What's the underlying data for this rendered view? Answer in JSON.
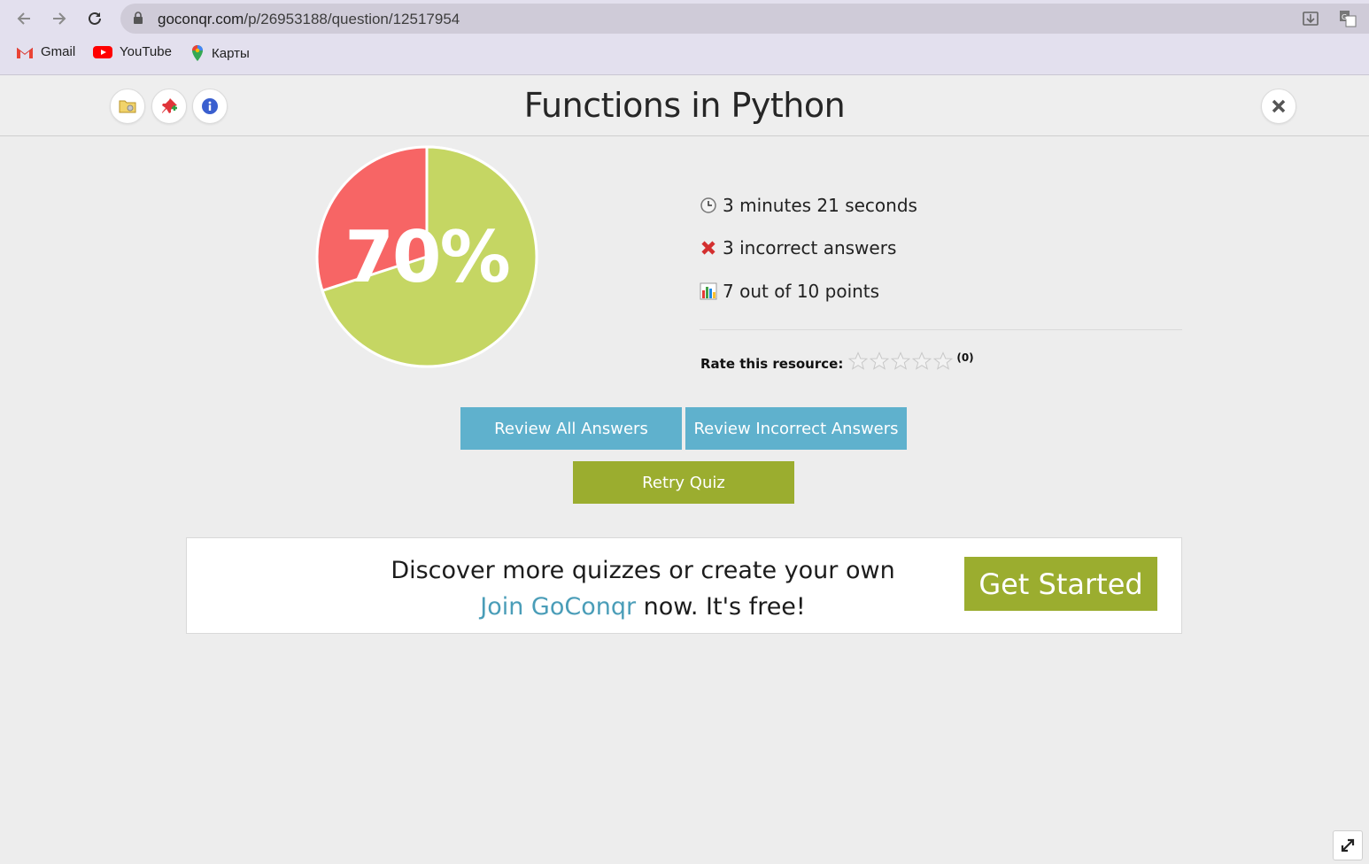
{
  "browser": {
    "url_host": "goconqr.com",
    "url_path": "/p/26953188/question/12517954",
    "bookmarks": [
      {
        "label": "Gmail",
        "icon": "gmail-icon"
      },
      {
        "label": "YouTube",
        "icon": "youtube-icon"
      },
      {
        "label": "Карты",
        "icon": "maps-pin-icon"
      }
    ]
  },
  "header": {
    "title": "Functions in Python",
    "buttons": [
      "folder-icon",
      "pin-icon",
      "info-icon",
      "close-icon"
    ]
  },
  "result": {
    "percent_label": "70%",
    "correct_fraction": 0.7,
    "time": "3 minutes 21 seconds",
    "incorrect": "3 incorrect answers",
    "points": "7 out of 10 points",
    "rate_label": "Rate this resource:",
    "rating_count": "(0)",
    "stars_total": 5,
    "stars_filled": 0,
    "colors": {
      "correct": "#c5d663",
      "incorrect": "#f76565"
    }
  },
  "actions": {
    "review_all": "Review All Answers",
    "review_incorrect": "Review Incorrect Answers",
    "retry": "Retry Quiz"
  },
  "promo": {
    "line1": "Discover more quizzes or create your own",
    "link": "Join GoConqr",
    "line2_rest": " now. It's free!",
    "cta": "Get Started"
  }
}
